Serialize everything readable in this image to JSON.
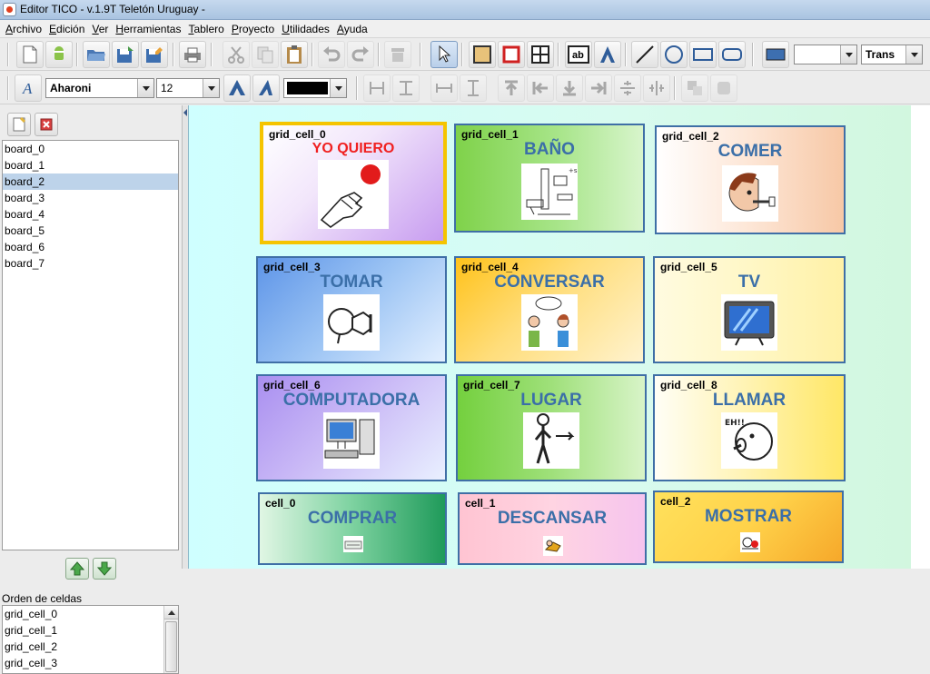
{
  "window": {
    "title": "Editor TICO - v.1.9T Teletón Uruguay -"
  },
  "menu": [
    "Archivo",
    "Edición",
    "Ver",
    "Herramientas",
    "Tablero",
    "Proyecto",
    "Utilidades",
    "Ayuda"
  ],
  "format_toolbar": {
    "font_family": "Aharoni",
    "font_size": "12",
    "color_swatch": "#000000"
  },
  "shape_toolbar": {
    "border_combo": "",
    "fill_combo": "Trans"
  },
  "boards": [
    "board_0",
    "board_1",
    "board_2",
    "board_3",
    "board_4",
    "board_5",
    "board_6",
    "board_7"
  ],
  "selected_board": "board_2",
  "cell_order": {
    "label": "Orden de celdas",
    "items": [
      "grid_cell_0",
      "grid_cell_1",
      "grid_cell_2",
      "grid_cell_3"
    ]
  },
  "cells": [
    {
      "id": "grid_cell_0",
      "label": "YO QUIERO",
      "picture": "want-hand-icon"
    },
    {
      "id": "grid_cell_1",
      "label": "BAÑO",
      "picture": "bathroom-icon"
    },
    {
      "id": "grid_cell_2",
      "label": "COMER",
      "picture": "eat-icon"
    },
    {
      "id": "grid_cell_3",
      "label": "TOMAR",
      "picture": "drink-icon"
    },
    {
      "id": "grid_cell_4",
      "label": "CONVERSAR",
      "picture": "talk-icon"
    },
    {
      "id": "grid_cell_5",
      "label": "TV",
      "picture": "tv-icon"
    },
    {
      "id": "grid_cell_6",
      "label": "COMPUTADORA",
      "picture": "computer-icon"
    },
    {
      "id": "grid_cell_7",
      "label": "LUGAR",
      "picture": "place-icon"
    },
    {
      "id": "grid_cell_8",
      "label": "LLAMAR",
      "picture": "call-icon"
    },
    {
      "id": "cell_0",
      "label": "COMPRAR",
      "picture": "buy-icon"
    },
    {
      "id": "cell_1",
      "label": "DESCANSAR",
      "picture": "rest-icon"
    },
    {
      "id": "cell_2",
      "label": "MOSTRAR",
      "picture": "show-icon"
    }
  ],
  "sample_text": "ab"
}
